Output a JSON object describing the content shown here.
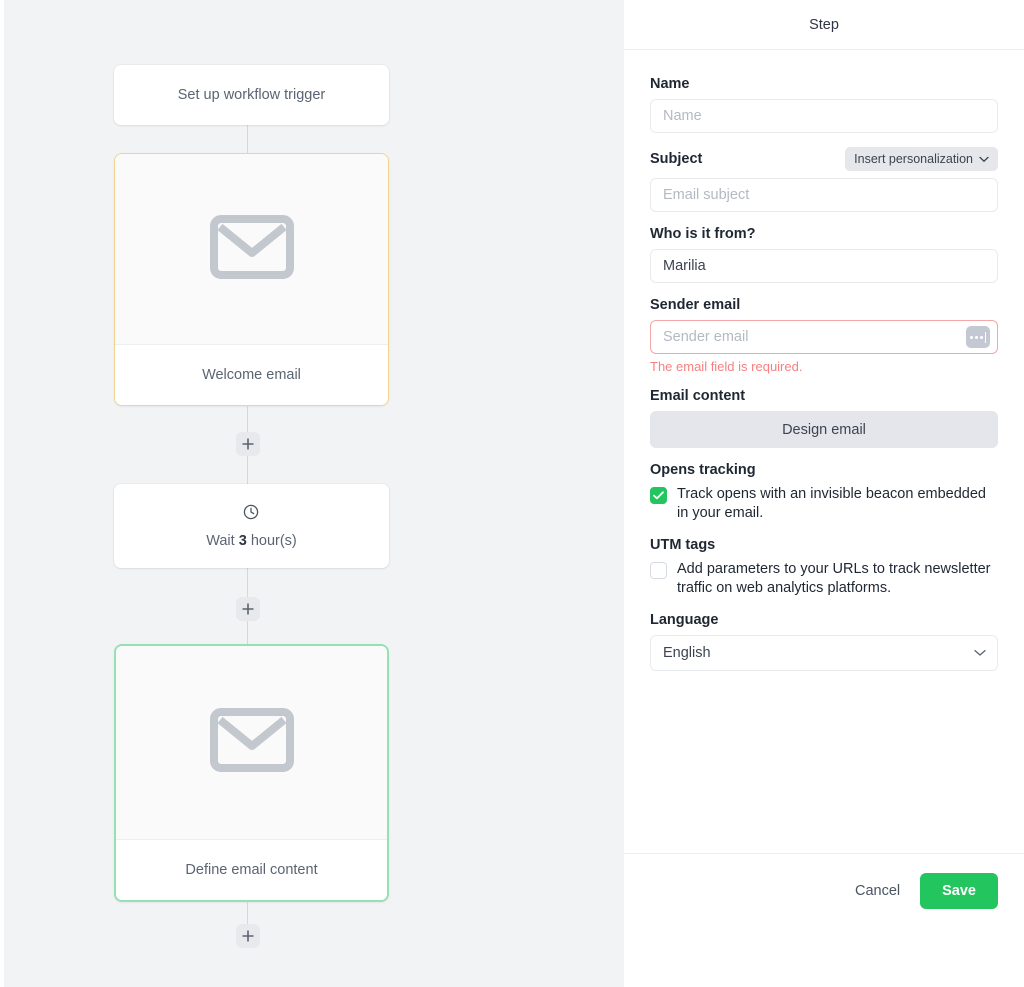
{
  "canvas": {
    "accent_amber": "#f3d38f",
    "accent_green": "#96e0b4",
    "background": "#f1f3f5",
    "add_icon": "plus-icon",
    "nodes": [
      {
        "id": "trigger",
        "type": "simple",
        "label": "Set up workflow trigger",
        "icon": "",
        "selected": false
      },
      {
        "id": "welcome-email",
        "type": "email",
        "label": "Welcome email",
        "icon": "envelope-icon",
        "state": "amber"
      },
      {
        "id": "wait",
        "type": "wait",
        "label": "Wait 3 hour(s)",
        "label_prefix": "Wait ",
        "label_value": "3",
        "label_suffix": " hour(s)",
        "icon": "clock-icon"
      },
      {
        "id": "define-email-content",
        "type": "email",
        "label": "Define email content",
        "icon": "envelope-icon",
        "state": "green"
      }
    ]
  },
  "panel": {
    "header": {
      "title": "Step"
    },
    "name": {
      "label": "Name",
      "value": "",
      "placeholder": "Name"
    },
    "subject": {
      "label": "Subject",
      "value": "",
      "placeholder": "Email subject",
      "personalization_button": "Insert personalization",
      "personalization_icon": "chevron-down-icon"
    },
    "who_from": {
      "label": "Who is it from?",
      "value": "Marilia",
      "placeholder": ""
    },
    "sender_email": {
      "label": "Sender email",
      "value": "",
      "placeholder": "Sender email",
      "error": "The email field is required.",
      "error_color": "#f98080",
      "ellipsis_icon": "ellipsis-input-icon"
    },
    "email_content": {
      "label": "Email content",
      "button": "Design email"
    },
    "opens_tracking": {
      "label": "Opens tracking",
      "checkbox_label": "Track opens with an invisible beacon embedded in your email.",
      "checked": true,
      "check_color": "#22c55e"
    },
    "utm_tags": {
      "label": "UTM tags",
      "checkbox_label": "Add parameters to your URLs to track newsletter traffic on web analytics platforms.",
      "checked": false
    },
    "language": {
      "label": "Language",
      "value": "English",
      "chevron_icon": "chevron-down-icon",
      "options": [
        "English"
      ]
    },
    "footer": {
      "cancel": "Cancel",
      "save": "Save",
      "save_color": "#22c55e"
    }
  }
}
